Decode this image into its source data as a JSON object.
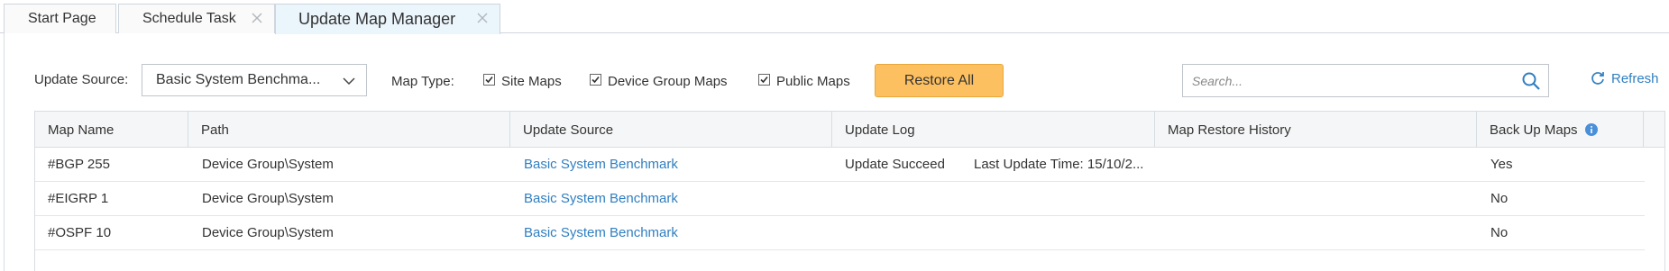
{
  "tabs": [
    {
      "label": "Start Page"
    },
    {
      "label": "Schedule Task"
    },
    {
      "label": "Update Map Manager"
    }
  ],
  "toolbar": {
    "update_source_label": "Update Source:",
    "update_source_value": "Basic System Benchma...",
    "map_type_label": "Map Type:",
    "site_maps_label": "Site Maps",
    "device_group_maps_label": "Device Group Maps",
    "public_maps_label": "Public Maps",
    "restore_all_label": "Restore All",
    "search_placeholder": "Search...",
    "refresh_label": "Refresh"
  },
  "table": {
    "columns": [
      "Map Name",
      "Path",
      "Update Source",
      "Update Log",
      "Map Restore History",
      "Back Up Maps"
    ],
    "rows": [
      {
        "map_name": "#BGP 255",
        "path": "Device Group\\System",
        "update_source": "Basic System Benchmark",
        "update_status": "Update Succeed",
        "update_time": "Last Update Time: 15/10/2...",
        "backup": "Yes"
      },
      {
        "map_name": "#EIGRP 1",
        "path": "Device Group\\System",
        "update_source": "Basic System Benchmark",
        "update_status": "",
        "update_time": "",
        "backup": "No"
      },
      {
        "map_name": "#OSPF 10",
        "path": "Device Group\\System",
        "update_source": "Basic System Benchmark",
        "update_status": "",
        "update_time": "",
        "backup": "No"
      }
    ]
  },
  "colors": {
    "accent": "#2f7fc1",
    "restore_button": "#fdc060",
    "active_tab": "#ebf5fc"
  }
}
